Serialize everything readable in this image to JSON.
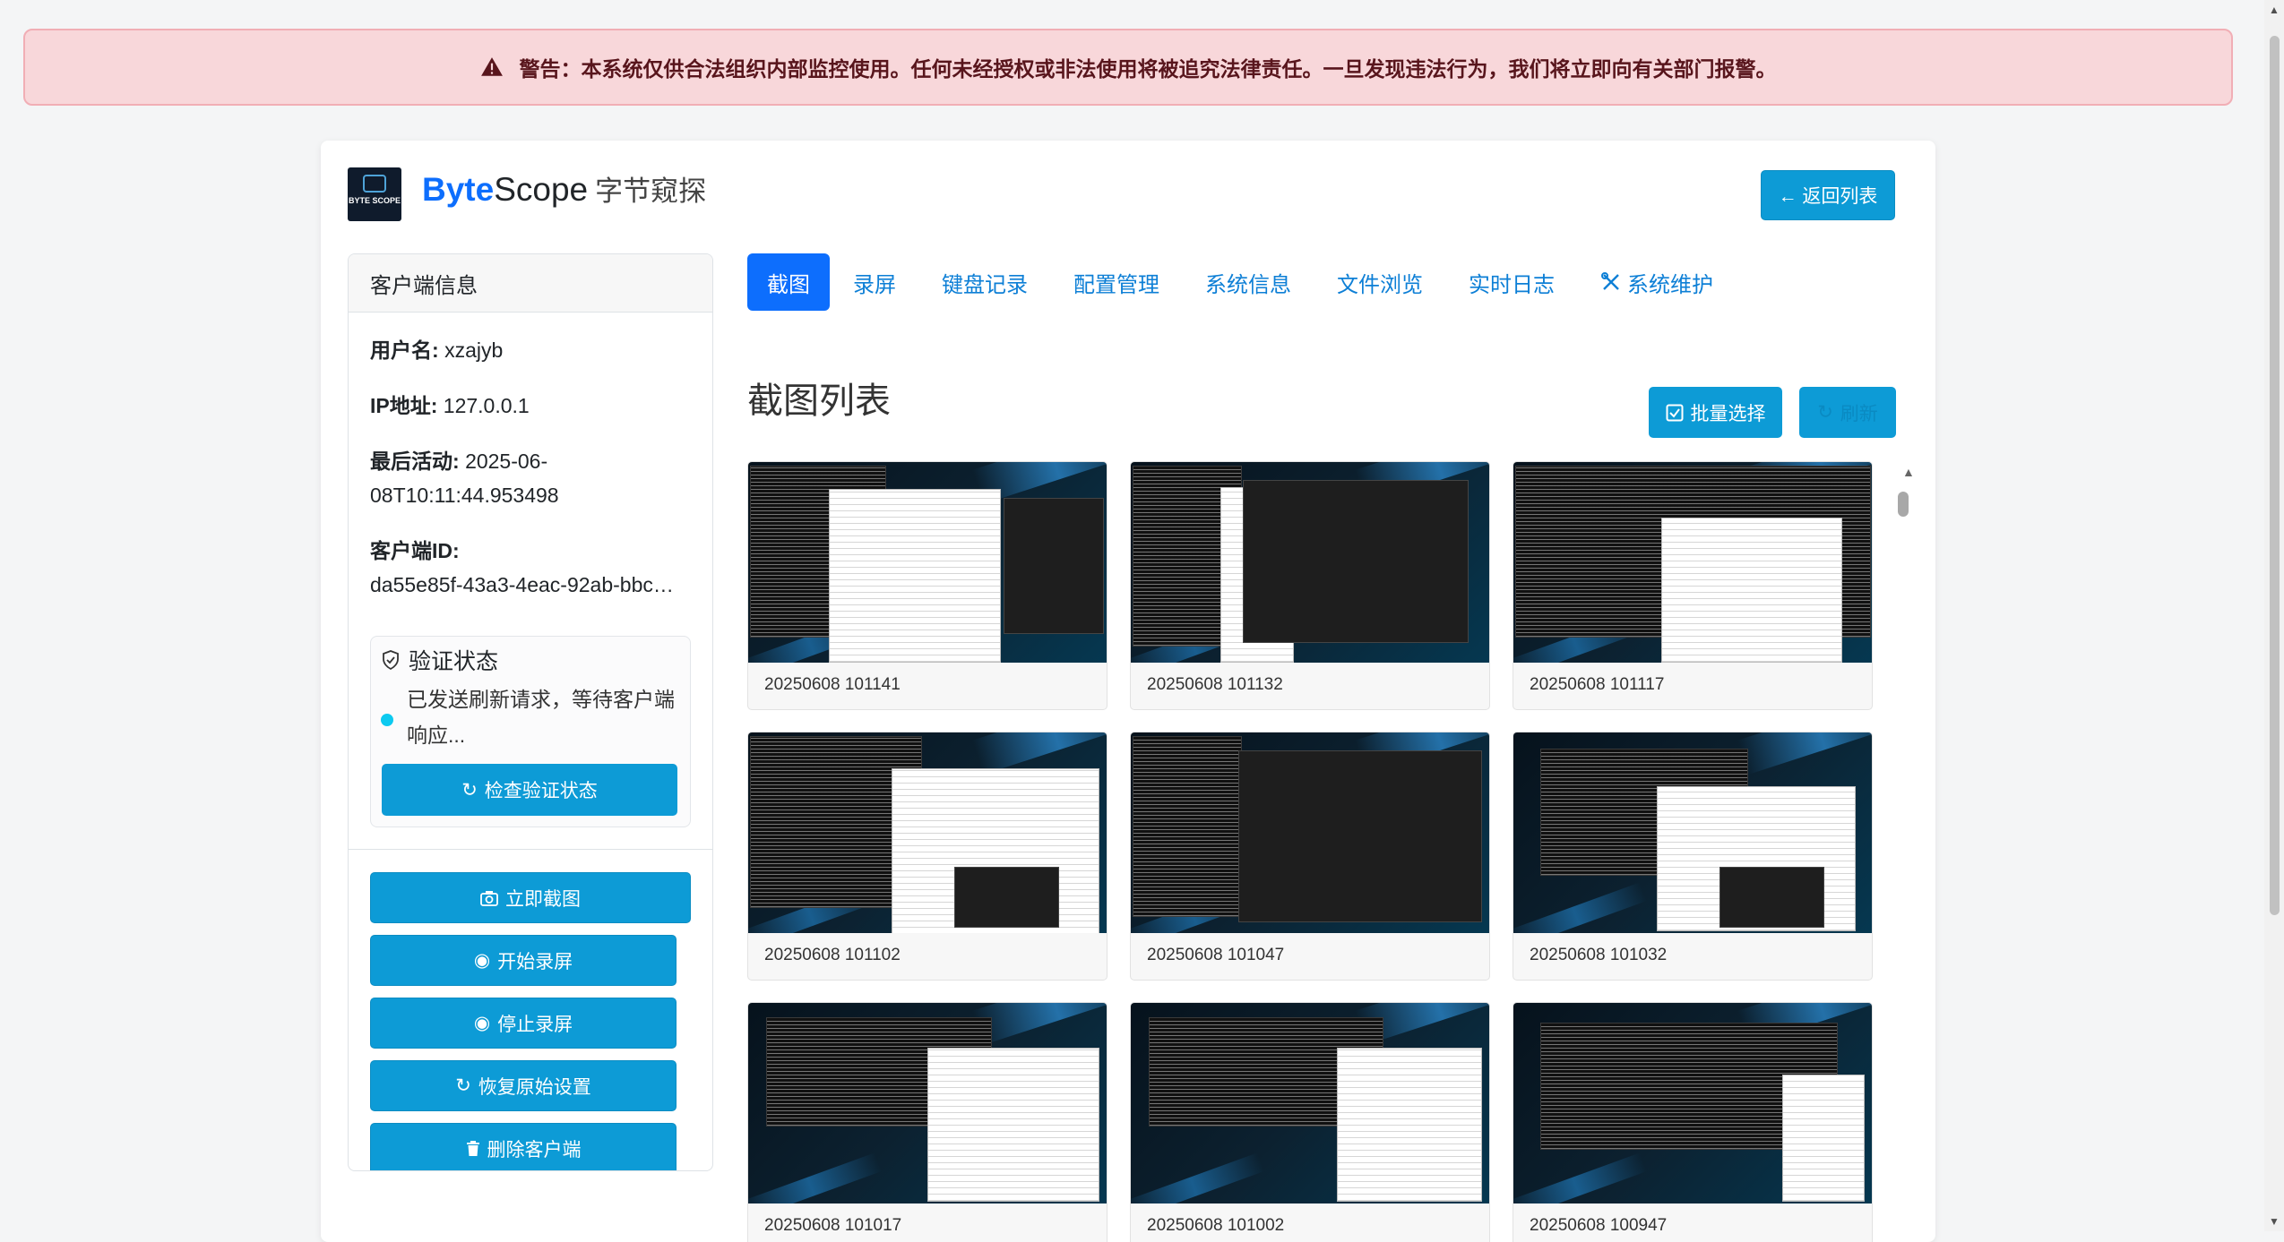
{
  "alert": {
    "text": "警告：本系统仅供合法组织内部监控使用。任何未经授权或非法使用将被追究法律责任。一旦发现违法行为，我们将立即向有关部门报警。",
    "icon": "warning-triangle-icon"
  },
  "brand": {
    "logo_text": "BYTE SCOPE",
    "name_bold": "Byte",
    "name_rest": "Scope",
    "name_cn": "字节窥探"
  },
  "header": {
    "back_label": "← 返回列表"
  },
  "sidebar": {
    "title": "客户端信息",
    "username_label": "用户名:",
    "username": "xzajyb",
    "ip_label": "IP地址:",
    "ip": "127.0.0.1",
    "last_active_label": "最后活动:",
    "last_active_1": "2025-06-",
    "last_active_2": "08T10:11:44.953498",
    "client_id_label": "客户端ID:",
    "client_id": "da55e85f-43a3-4eac-92ab-bbc…",
    "verify": {
      "title": "验证状态",
      "message": "已发送刷新请求，等待客户端响应...",
      "button": "检查验证状态"
    },
    "buttons": {
      "screenshot": "立即截图",
      "start_record": "开始录屏",
      "stop_record": "停止录屏",
      "restore": "恢复原始设置",
      "delete": "删除客户端"
    }
  },
  "tabs": [
    "截图",
    "录屏",
    "键盘记录",
    "配置管理",
    "系统信息",
    "文件浏览",
    "实时日志",
    "系统维护"
  ],
  "main": {
    "title": "截图列表",
    "batch_label": "批量选择",
    "refresh_label": "刷新"
  },
  "screenshots": [
    "20250608 101141",
    "20250608 101132",
    "20250608 101117",
    "20250608 101102",
    "20250608 101047",
    "20250608 101032",
    "20250608 101017",
    "20250608 101002",
    "20250608 100947"
  ],
  "colors": {
    "primary": "#0d6efd",
    "info_button": "#0d9bd6",
    "alert_bg": "#f8d7da",
    "alert_text": "#58151c"
  }
}
